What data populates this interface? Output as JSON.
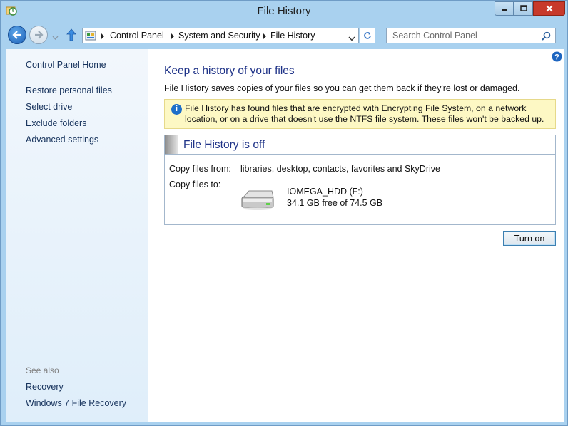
{
  "window": {
    "title": "File History",
    "icon": "file-history-icon"
  },
  "nav": {
    "breadcrumbs": [
      "Control Panel",
      "System and Security",
      "File History"
    ],
    "search_placeholder": "Search Control Panel"
  },
  "sidebar": {
    "links": [
      "Control Panel Home",
      "Restore personal files",
      "Select drive",
      "Exclude folders",
      "Advanced settings"
    ],
    "see_also_heading": "See also",
    "see_also_links": [
      "Recovery",
      "Windows 7 File Recovery"
    ]
  },
  "main": {
    "title": "Keep a history of your files",
    "description": "File History saves copies of your files so you can get them back if they're lost or damaged.",
    "warning": "File History has found files that are encrypted with Encrypting File System, on a network location, or on a drive that doesn't use the NTFS file system. These files won't be backed up.",
    "status_title": "File History is off",
    "copy_from_label": "Copy files from:",
    "copy_from_value": "libraries, desktop, contacts, favorites and SkyDrive",
    "copy_to_label": "Copy files to:",
    "drive_name": "IOMEGA_HDD (F:)",
    "drive_free": "34.1 GB free of 74.5 GB",
    "turn_on_label": "Turn on"
  },
  "colors": {
    "heading": "#1e3287",
    "link": "#16325c",
    "warning_bg": "#fdf8c4",
    "accent": "#1b5fb5"
  }
}
